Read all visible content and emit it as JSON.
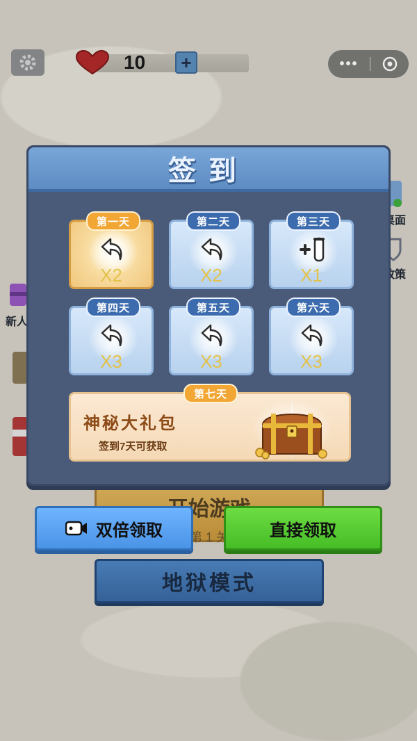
{
  "topbar": {
    "lives": "10",
    "add_label": "+",
    "more_label": "•••"
  },
  "side": {
    "left_1": "新人",
    "right_1": "桌面",
    "right_2": "政策"
  },
  "menu": {
    "start_label": "开始游戏",
    "start_sub": "第 1 关",
    "hell_label": "地狱模式"
  },
  "checkin": {
    "title": "签到",
    "days": [
      {
        "tag": "第一天",
        "reward": "X2",
        "icon": "undo-arrow-icon"
      },
      {
        "tag": "第二天",
        "reward": "X2",
        "icon": "undo-arrow-icon"
      },
      {
        "tag": "第三天",
        "reward": "X1",
        "icon": "add-tube-icon"
      },
      {
        "tag": "第四天",
        "reward": "X3",
        "icon": "undo-arrow-icon"
      },
      {
        "tag": "第五天",
        "reward": "X3",
        "icon": "undo-arrow-icon"
      },
      {
        "tag": "第六天",
        "reward": "X3",
        "icon": "undo-arrow-icon"
      }
    ],
    "day7": {
      "tag": "第七天",
      "title": "神秘大礼包",
      "subtitle": "签到7天可获取"
    }
  },
  "buttons": {
    "double_label": "双倍领取",
    "direct_label": "直接领取"
  },
  "colors": {
    "panel": "#4a5b79",
    "header": "#6a98cf",
    "gold": "#f2a634",
    "green": "#55c832",
    "blue": "#5aa3f5"
  }
}
